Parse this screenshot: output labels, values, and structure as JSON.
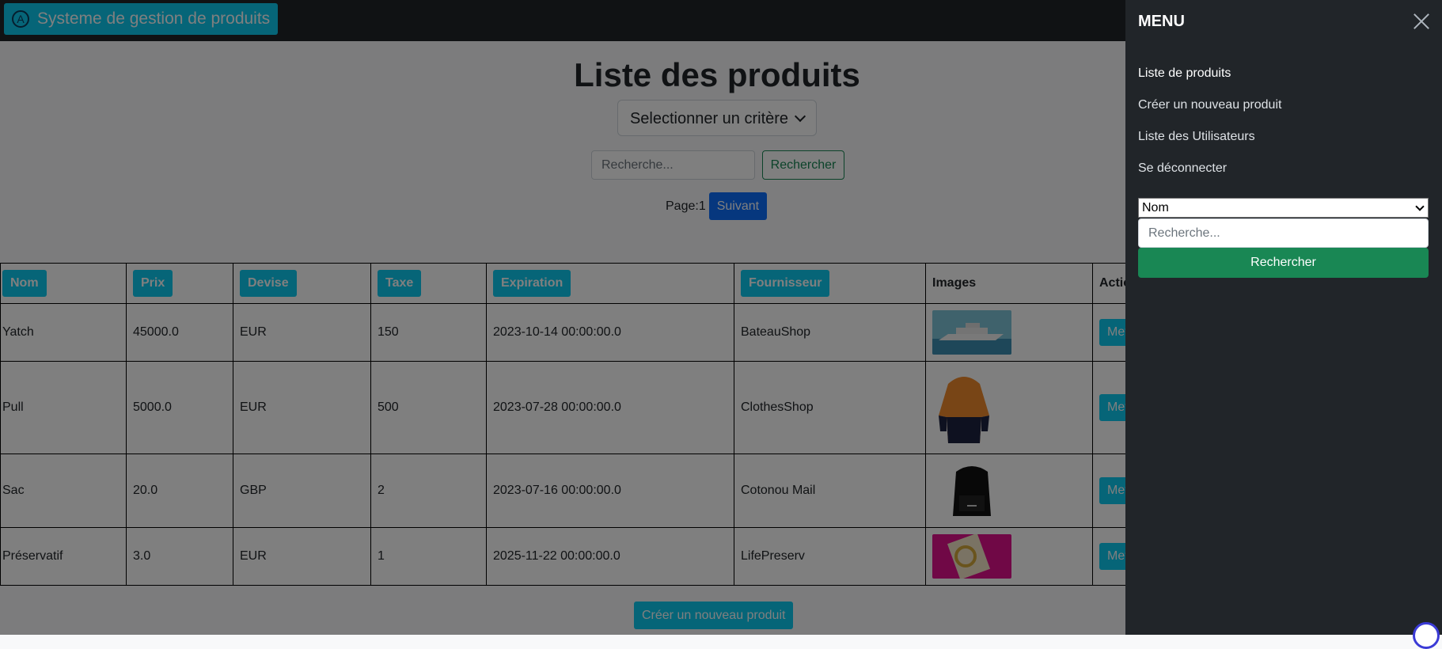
{
  "navbar": {
    "brand": "Systeme de gestion de produits"
  },
  "main": {
    "title": "Liste des produits",
    "criteria_select": "Selectionner un critère",
    "search_placeholder": "Recherche...",
    "search_button": "Rechercher",
    "page_label": "Page:1",
    "next_button": "Suivant",
    "create_button": "Créer un nouveau produit"
  },
  "table": {
    "headers": [
      "Nom",
      "Prix",
      "Devise",
      "Taxe",
      "Expiration",
      "Fournisseur",
      "Images",
      "Actio"
    ],
    "action_label": "Met",
    "rows": [
      {
        "nom": "Yatch",
        "prix": "45000.0",
        "devise": "EUR",
        "taxe": "150",
        "expiration": "2023-10-14 00:00:00.0",
        "fournisseur": "BateauShop"
      },
      {
        "nom": "Pull",
        "prix": "5000.0",
        "devise": "EUR",
        "taxe": "500",
        "expiration": "2023-07-28 00:00:00.0",
        "fournisseur": "ClothesShop"
      },
      {
        "nom": "Sac",
        "prix": "20.0",
        "devise": "GBP",
        "taxe": "2",
        "expiration": "2023-07-16 00:00:00.0",
        "fournisseur": "Cotonou Mail"
      },
      {
        "nom": "Préservatif",
        "prix": "3.0",
        "devise": "EUR",
        "taxe": "1",
        "expiration": "2025-11-22 00:00:00.0",
        "fournisseur": "LifePreserv"
      }
    ]
  },
  "sidebar": {
    "title": "MENU",
    "links": [
      "Liste de produits",
      "Créer un nouveau produit",
      "Liste des Utilisateurs",
      "Se déconnecter"
    ],
    "select_value": "Nom",
    "search_placeholder": "Recherche...",
    "search_button": "Rechercher"
  },
  "colors": {
    "info": "#0dcaf0",
    "primary": "#0d6efd",
    "success": "#198754",
    "dark": "#212529"
  }
}
